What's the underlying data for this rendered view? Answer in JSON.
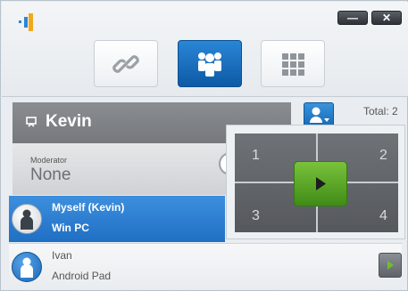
{
  "window": {
    "minimize_label": "—",
    "close_label": "✕"
  },
  "toolbar": {
    "modes": [
      {
        "icon": "link-icon"
      },
      {
        "icon": "users-group-icon",
        "active": true
      },
      {
        "icon": "grid-icon"
      }
    ]
  },
  "presenter": {
    "name": "Kevin"
  },
  "moderator": {
    "label": "Moderator",
    "value": "None"
  },
  "total": "Total: 2",
  "participants": [
    {
      "name": "Myself (Kevin)",
      "device": "Win PC",
      "selected": true
    },
    {
      "name": "Ivan",
      "device": "Android Pad",
      "selected": false
    }
  ],
  "split_popup": {
    "quadrants": [
      "1",
      "2",
      "3",
      "4"
    ]
  },
  "colors": {
    "accent": "#1f6fc4",
    "play_green": "#5aa82a",
    "header_gray": "#7f8286"
  }
}
